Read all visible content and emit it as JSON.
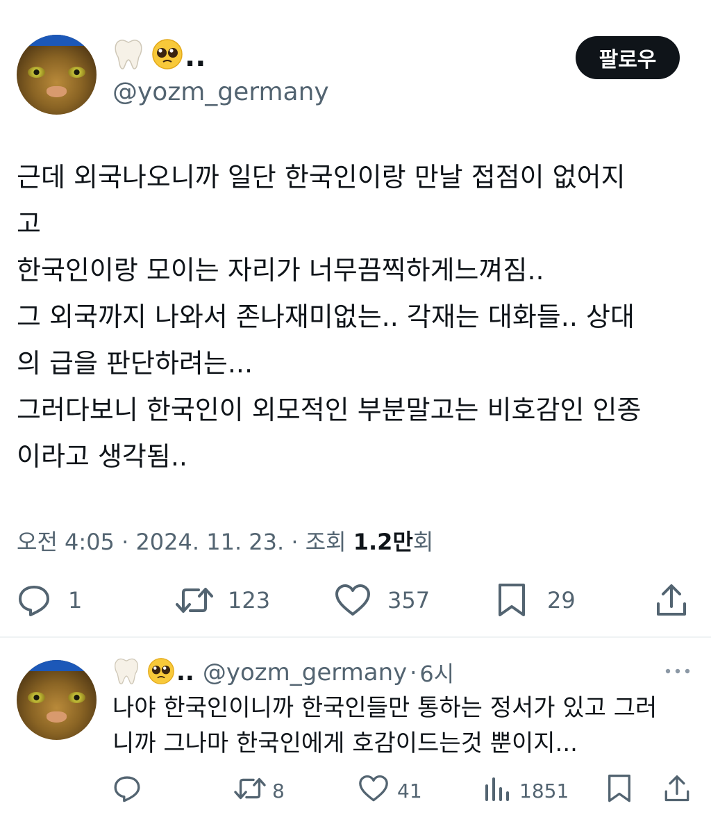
{
  "tweet": {
    "author": {
      "emoji_name": "tooth-emoji + pleading-face-emoji",
      "name_suffix": "..",
      "handle": "@yozm_germany"
    },
    "follow_label": "팔로우",
    "text_lines": [
      "근데 외국나오니까 일단 한국인이랑 만날 접점이 없어지",
      "고",
      "한국인이랑 모이는 자리가 너무끔찍하게느껴짐..",
      "그 외국까지 나와서 존나재미없는.. 각재는 대화들.. 상대",
      "의 급을 판단하려는...",
      "그러다보니 한국인이 외모적인 부분말고는 비호감인 인종",
      "이라고 생각됨.."
    ],
    "meta": {
      "time": "오전 4:05",
      "sep": "·",
      "date": "2024. 11. 23.",
      "views_label": "조회",
      "views_value": "1.2만",
      "views_unit": "회"
    },
    "actions": {
      "replies": "1",
      "retweets": "123",
      "likes": "357",
      "bookmarks": "29"
    }
  },
  "reply": {
    "author": {
      "name_suffix": "..",
      "handle": "@yozm_germany",
      "sep": "·",
      "time": "6시"
    },
    "text_lines": [
      "나야 한국인이니까 한국인들만 통하는 정서가 있고 그러",
      "니까 그나마 한국인에게 호감이드는것 뿐이지..."
    ],
    "actions": {
      "retweets": "8",
      "likes": "41",
      "views": "1851"
    }
  },
  "colors": {
    "text": "#0f1419",
    "secondary": "#536471",
    "button_bg": "#0f1419",
    "divider": "#eff3f4"
  }
}
